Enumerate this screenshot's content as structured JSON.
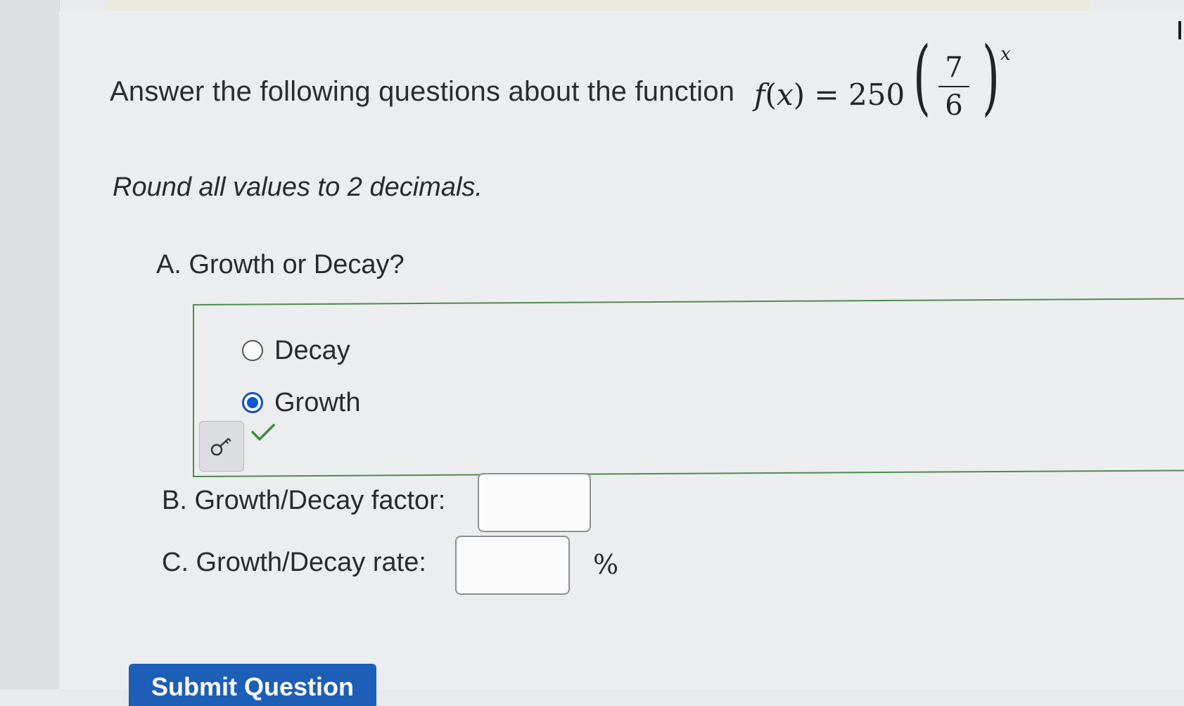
{
  "question": {
    "title": "Answer the following questions about the function",
    "formula": {
      "lhs_func": "f",
      "lhs_var": "x",
      "equals": "=",
      "coefficient": "250",
      "numerator": "7",
      "denominator": "6",
      "exponent": "x"
    },
    "instruction": "Round all values to 2 decimals."
  },
  "part_a": {
    "label": "A. Growth or Decay?",
    "options": [
      {
        "label": "Decay",
        "selected": false
      },
      {
        "label": "Growth",
        "selected": true
      }
    ],
    "status": "correct",
    "accent_color": "#4f8a4f",
    "key_icon": "key-icon",
    "check_icon": "checkmark-icon"
  },
  "part_b": {
    "label": "B. Growth/Decay factor:",
    "value": ""
  },
  "part_c": {
    "label": "C. Growth/Decay rate:",
    "value": "",
    "unit": "%"
  },
  "submit": {
    "label": "Submit Question",
    "color": "#1d5fb6"
  }
}
